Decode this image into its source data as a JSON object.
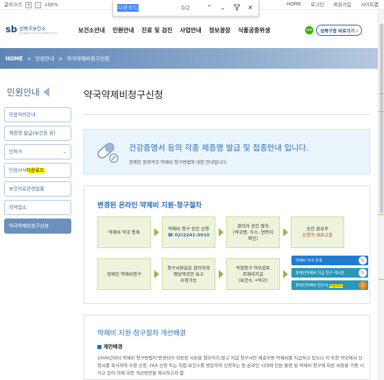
{
  "utility": {
    "fontsize_label": "글자크기",
    "plus": "+",
    "minus": "-",
    "zoom": "100%",
    "links": [
      "HOME",
      "로그인",
      "회원가입",
      "사이트맵"
    ]
  },
  "find": {
    "query": "다운로드",
    "count": "0/2"
  },
  "header": {
    "logo_mark": "sb",
    "logo_name": "성북구보건소",
    "logo_sub": "Seongbuk Community Health Center",
    "gnb": [
      "보건소안내",
      "민원안내",
      "진료 및 검진",
      "사업안내",
      "정보광장",
      "식품공중위생"
    ],
    "talk_icon": "talk",
    "site_button": "성북구청 바로가기 ›"
  },
  "breadcrumb": {
    "home": "HOME",
    "sep": ">",
    "items": [
      "민원안내",
      "약국약제비청구신청"
    ]
  },
  "sidebar": {
    "title": "민원안내",
    "items": [
      {
        "label": "민원처리안내"
      },
      {
        "label": "제증명 발급(보건증 등)"
      },
      {
        "label": "인허가",
        "chevron": "⌄"
      },
      {
        "label_pre": "민원서식",
        "label_hl": "다운로드"
      },
      {
        "label": "보건의료관련법률"
      },
      {
        "label": "의약업소"
      },
      {
        "label": "약국약제비청구신청"
      }
    ]
  },
  "main": {
    "title": "약국약제비청구신청",
    "notice": {
      "heading": "건강증명서 등의 각종 제증명 발급 및 접종안내 입니다.",
      "sub": "장애인 원외약국 약제비 청구방법에 대한 안내입니다."
    },
    "process": {
      "title": "변경된 온라인 약제비 지원·청구절차",
      "row1": [
        {
          "l1": "약제비 약국 등록"
        },
        {
          "l1": "약제비 청구 승인 신청",
          "l2": "☎ 02)2241-5910"
        },
        {
          "l1": "관리자 승인 절차",
          "l2": "(약국명, 주소, 연락처",
          "l3": "확인)"
        },
        {
          "l1": "승인 완료후",
          "l2": "신청자 새로고침"
        }
      ],
      "row2": [
        {
          "l1": "장애인 약제비청구"
        },
        {
          "l1": "청구서파일은 관리자와",
          "l2": "해당약국만 보고",
          "l3": "수정가능"
        },
        {
          "l1": "적정청구 여부검토",
          "l2": "조제비지급",
          "l3": "(보건소 →약국)"
        }
      ],
      "buttons": [
        {
          "label": "약제비 약국 등록",
          "icon": "↻"
        },
        {
          "label": "장애인약제비 지급 청구 게시판",
          "icon": "↻"
        },
        {
          "label_pre": "장애인약제비 청구서 ",
          "label_hl": "다운로드",
          "icon": "↓"
        }
      ]
    },
    "background": {
      "title": "약제비 지원·청구절차 개선배경",
      "subhead": "제안배경",
      "body": "2006년부터 약제비 청구방법이 변경되어 처방전 사본을 첨부하지 않고 지급 청구서만 제출하면 약제비를 지급하고 있으나 이 또한 약국에서 신청서를 복사하여 우편 신청, FAX 신청 또는 직접 보건소를 방문하여 신청하는 등 온라인 시대에 민원 불편 및 약제비 청구에 따른 비용을 가중 시키고 있어 이에 대한 개선방안을 제시하고자 함."
    }
  }
}
